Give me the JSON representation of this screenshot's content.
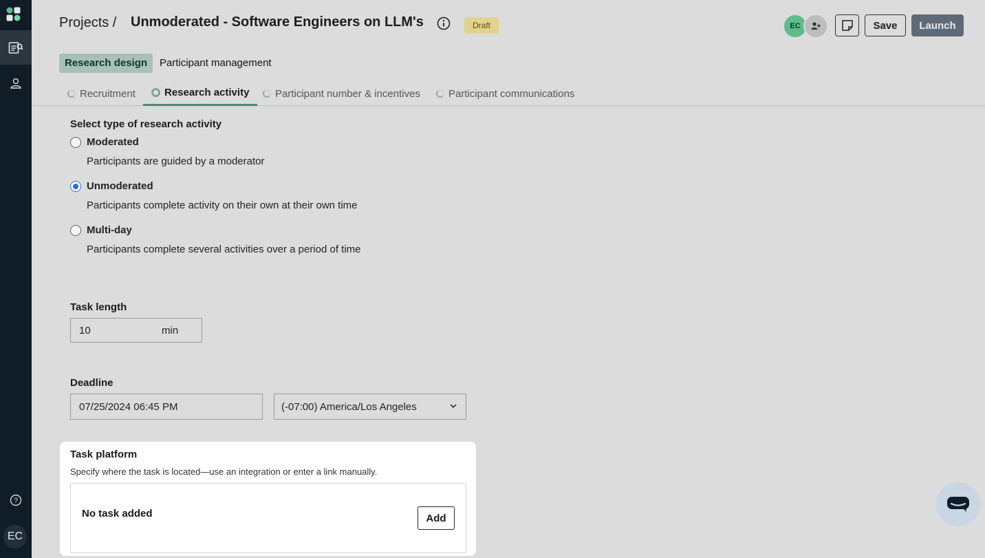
{
  "sidebar": {
    "avatar_initials": "EC",
    "items": [
      {
        "icon": "research-icon",
        "active": true
      },
      {
        "icon": "participants-icon",
        "active": false
      },
      {
        "icon": "help-icon",
        "active": false
      }
    ]
  },
  "header": {
    "breadcrumb": "Projects /",
    "title": "Unmoderated - Software Engineers on LLM's",
    "status_badge": "Draft",
    "collaborator_initials": "EC",
    "save_label": "Save",
    "launch_label": "Launch"
  },
  "section_tabs": [
    {
      "label": "Research design",
      "active": true
    },
    {
      "label": "Participant management",
      "active": false
    }
  ],
  "sub_tabs": [
    {
      "label": "Recruitment",
      "active": false
    },
    {
      "label": "Research activity",
      "active": true
    },
    {
      "label": "Participant number & incentives",
      "active": false
    },
    {
      "label": "Participant communications",
      "active": false
    }
  ],
  "research_activity": {
    "heading": "Select type of research activity",
    "options": [
      {
        "title": "Moderated",
        "description": "Participants are guided by a moderator",
        "checked": false
      },
      {
        "title": "Unmoderated",
        "description": "Participants complete activity on their own at their own time",
        "checked": true
      },
      {
        "title": "Multi-day",
        "description": "Participants complete several activities over a period of time",
        "checked": false
      }
    ]
  },
  "task_length": {
    "label": "Task length",
    "value": "10",
    "unit": "min"
  },
  "deadline": {
    "label": "Deadline",
    "datetime": "07/25/2024 06:45 PM",
    "timezone": "(-07:00) America/Los Angeles"
  },
  "task_platform": {
    "title": "Task platform",
    "description": "Specify where the task is located—use an integration or enter a link manually.",
    "empty_text": "No task added",
    "add_label": "Add"
  },
  "colors": {
    "sidebar_bg": "#101c26",
    "accent_green": "#a6c2b6",
    "launch_bg": "#5f6a78",
    "draft_badge": "#e2d38c",
    "radio_checked": "#2a6bd6"
  }
}
